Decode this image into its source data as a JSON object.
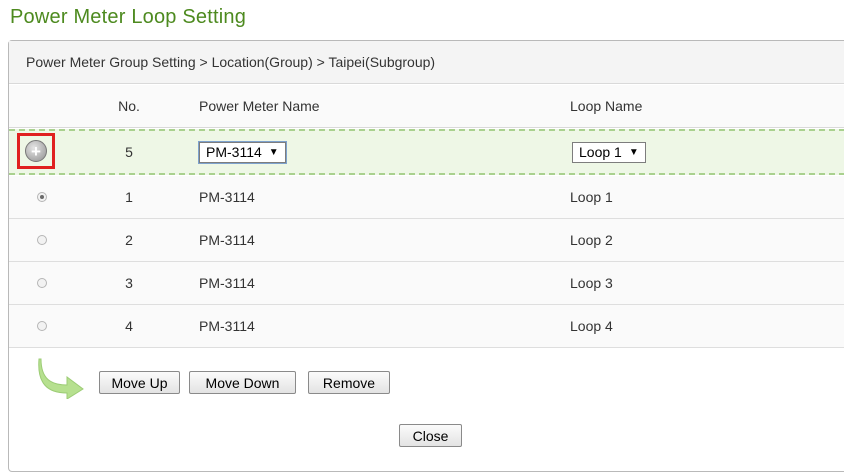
{
  "page": {
    "title": "Power Meter Loop Setting"
  },
  "breadcrumb": "Power Meter Group Setting > Location(Group) > Taipei(Subgroup)",
  "table": {
    "headers": {
      "no": "No.",
      "name": "Power Meter Name",
      "loop": "Loop Name"
    },
    "add_row": {
      "no": "5",
      "meter_select": "PM-3114",
      "loop_select": "Loop 1"
    },
    "rows": [
      {
        "no": "1",
        "name": "PM-3114",
        "loop": "Loop 1",
        "selected": true
      },
      {
        "no": "2",
        "name": "PM-3114",
        "loop": "Loop 2",
        "selected": false
      },
      {
        "no": "3",
        "name": "PM-3114",
        "loop": "Loop 3",
        "selected": false
      },
      {
        "no": "4",
        "name": "PM-3114",
        "loop": "Loop 4",
        "selected": false
      }
    ]
  },
  "actions": {
    "move_up": "Move Up",
    "move_down": "Move Down",
    "remove": "Remove",
    "close": "Close"
  },
  "icons": {
    "add": "plus-circle-icon",
    "arrow": "curved-arrow-icon",
    "select_arrow": "triangle-down-icon"
  },
  "colors": {
    "title": "#4d8a1f",
    "add_row_bg": "#eef7e6",
    "add_row_border": "#a9d18e",
    "highlight": "#e02020"
  }
}
